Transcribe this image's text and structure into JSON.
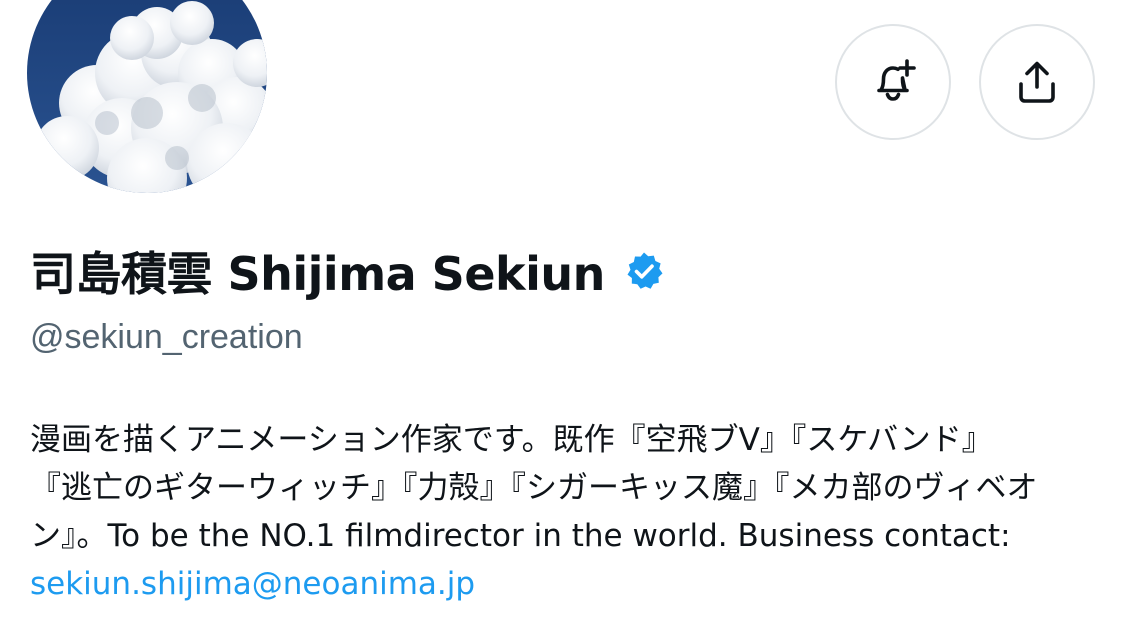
{
  "profile": {
    "display_name": "司島積雲 Shijima Sekiun",
    "handle": "@sekiun_creation",
    "verified_icon": "verified-badge-icon",
    "bio_lines": [
      "漫画を描くアニメーション作家です。既作『空飛ブV』『スケバンド』",
      "『逃亡のギターウィッチ』『力殻』『シガーキッス魔』『メカ部のヴィベオ",
      "ン』。To be the NO.1 filmdirector in the world. Business contact:"
    ],
    "bio_email": "sekiun.shijima@neoanima.jp"
  },
  "actions": {
    "notify_icon": "bell-plus-icon",
    "share_icon": "share-upload-icon"
  },
  "colors": {
    "text": "#0f1419",
    "secondary_text": "#536471",
    "link": "#1d9bf0",
    "verified": "#1d9bf0",
    "button_border": "#dfe3e6",
    "avatar_sky": "#1f3f78"
  }
}
